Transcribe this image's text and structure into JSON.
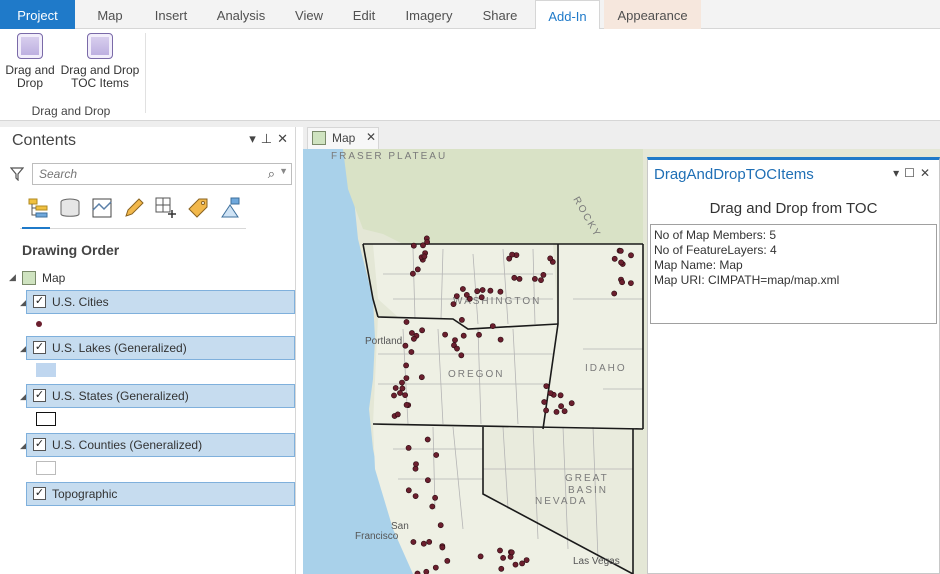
{
  "ribbon": {
    "tabs": [
      "Project",
      "Map",
      "Insert",
      "Analysis",
      "View",
      "Edit",
      "Imagery",
      "Share",
      "Add-In",
      "Appearance"
    ],
    "active_tab": "Add-In",
    "buttons": [
      {
        "label_line1": "Drag and",
        "label_line2": "Drop",
        "icon": "addin-button-icon"
      },
      {
        "label_line1": "Drag and Drop",
        "label_line2": "TOC Items",
        "icon": "addin-button-icon"
      }
    ],
    "group_label": "Drag and Drop"
  },
  "contents": {
    "title": "Contents",
    "controls": [
      "▾",
      "⊥",
      "✕"
    ],
    "search_placeholder": "Search",
    "tools": [
      "list-by-drawing-order-icon",
      "list-by-source-icon",
      "list-by-selection-icon",
      "list-by-editing-icon",
      "list-by-snapping-icon",
      "list-by-labeling-icon",
      "list-by-perspective-imagery-icon"
    ],
    "section_title": "Drawing Order",
    "map_label": "Map",
    "layers": [
      {
        "label": "U.S. Cities",
        "checked": "✓"
      },
      {
        "label": "U.S. Lakes (Generalized)",
        "checked": "✓"
      },
      {
        "label": "U.S. States (Generalized)",
        "checked": "✓"
      },
      {
        "label": "U.S. Counties (Generalized)",
        "checked": "✓"
      },
      {
        "label": "Topographic",
        "checked": "✓"
      }
    ]
  },
  "mapview": {
    "tab_label": "Map",
    "close": "✕",
    "labels": [
      "FRASER PLATEAU",
      "WASHINGTON",
      "OREGON",
      "IDAHO",
      "NEVADA",
      "GREAT",
      "BASIN",
      "Portland",
      "San",
      "Francisco",
      "Las Vegas",
      "ROCKY"
    ]
  },
  "dock": {
    "title": "DragAndDropTOCItems",
    "controls": [
      "▾",
      "☐",
      "✕"
    ],
    "heading": "Drag and Drop from TOC",
    "lines": [
      "No of Map Members: 5",
      "No of FeatureLayers: 4",
      "Map Name: Map",
      "Map URI: CIMPATH=map/map.xml"
    ]
  },
  "colors": {
    "accent": "#1f7ac9",
    "layer_highlight": "#c6dcef",
    "city_point": "#6b1f2e"
  }
}
